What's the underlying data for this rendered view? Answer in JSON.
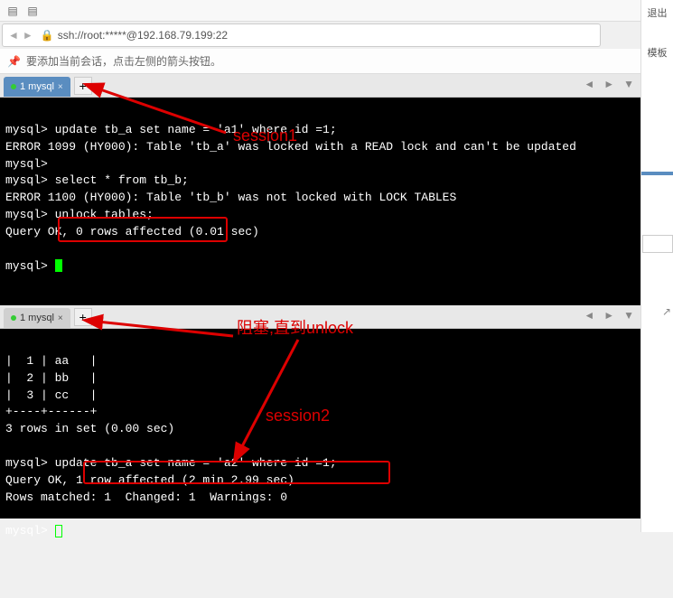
{
  "address": {
    "url": "ssh://root:*****@192.168.79.199:22"
  },
  "hint": {
    "text": "要添加当前会话，点击左侧的箭头按钮。"
  },
  "rightSidebar": {
    "exit": "退出",
    "template": "模板"
  },
  "tab1": {
    "label": "1 mysql",
    "add": "+"
  },
  "tab2": {
    "label": "1 mysql",
    "add": "+"
  },
  "term1": {
    "l1": "mysql> update tb_a set name = 'a1' where id =1;",
    "l2": "ERROR 1099 (HY000): Table 'tb_a' was locked with a READ lock and can't be updated",
    "l3": "mysql>",
    "l4": "mysql> select * from tb_b;",
    "l5": "ERROR 1100 (HY000): Table 'tb_b' was not locked with LOCK TABLES",
    "l6": "mysql> unlock tables;",
    "l7": "Query OK, 0 rows affected (0.01 sec)",
    "l8": "",
    "l9": "mysql> "
  },
  "term2": {
    "l1": "|  1 | aa   |",
    "l2": "|  2 | bb   |",
    "l3": "|  3 | cc   |",
    "l4": "+----+------+",
    "l5": "3 rows in set (0.00 sec)",
    "l6": "",
    "l7": "mysql> update tb_a set name = 'a2' where id =1;",
    "l8": "Query OK, 1 row affected (2 min 2.99 sec)",
    "l9": "Rows matched: 1  Changed: 1  Warnings: 0",
    "l10": "",
    "l11": "mysql> "
  },
  "annotations": {
    "session1": "session1",
    "blocking": "阻塞,直到unlock",
    "session2": "session2"
  }
}
